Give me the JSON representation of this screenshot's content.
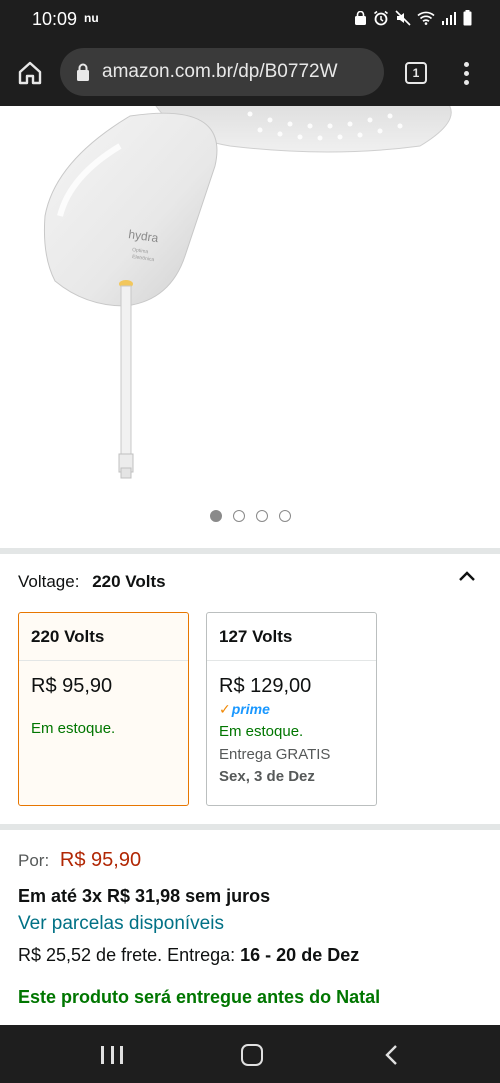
{
  "status_bar": {
    "time": "10:09",
    "carrier_badge": "nu"
  },
  "browser": {
    "url": "amazon.com.br/dp/B0772W",
    "tab_count": "1"
  },
  "product_image": {
    "brand_text": "hydra",
    "brand_subtext": "Optima\nEletrônica",
    "carousel_pages": 4,
    "carousel_active_index": 0
  },
  "variation": {
    "label": "Voltage:",
    "selected_value": "220 Volts",
    "options": [
      {
        "name": "220 Volts",
        "price": "R$ 95,90",
        "stock": "Em estoque.",
        "selected": true
      },
      {
        "name": "127 Volts",
        "price": "R$ 129,00",
        "prime": "prime",
        "stock": "Em estoque.",
        "delivery": "Entrega GRATIS",
        "delivery_date": "Sex, 3 de Dez",
        "selected": false
      }
    ]
  },
  "price": {
    "label": "Por:",
    "value": "R$ 95,90",
    "installment": "Em até 3x R$ 31,98 sem juros",
    "installment_link": "Ver parcelas disponíveis",
    "shipping_prefix": "R$ 25,52 de frete. Entrega: ",
    "shipping_dates": "16 - 20 de Dez",
    "christmas_note": "Este produto será entregue antes do Natal"
  },
  "colors": {
    "price_red": "#b12704",
    "stock_green": "#007600",
    "link_teal": "#007185",
    "selected_border": "#e77600",
    "prime_blue": "#1a98ff"
  }
}
